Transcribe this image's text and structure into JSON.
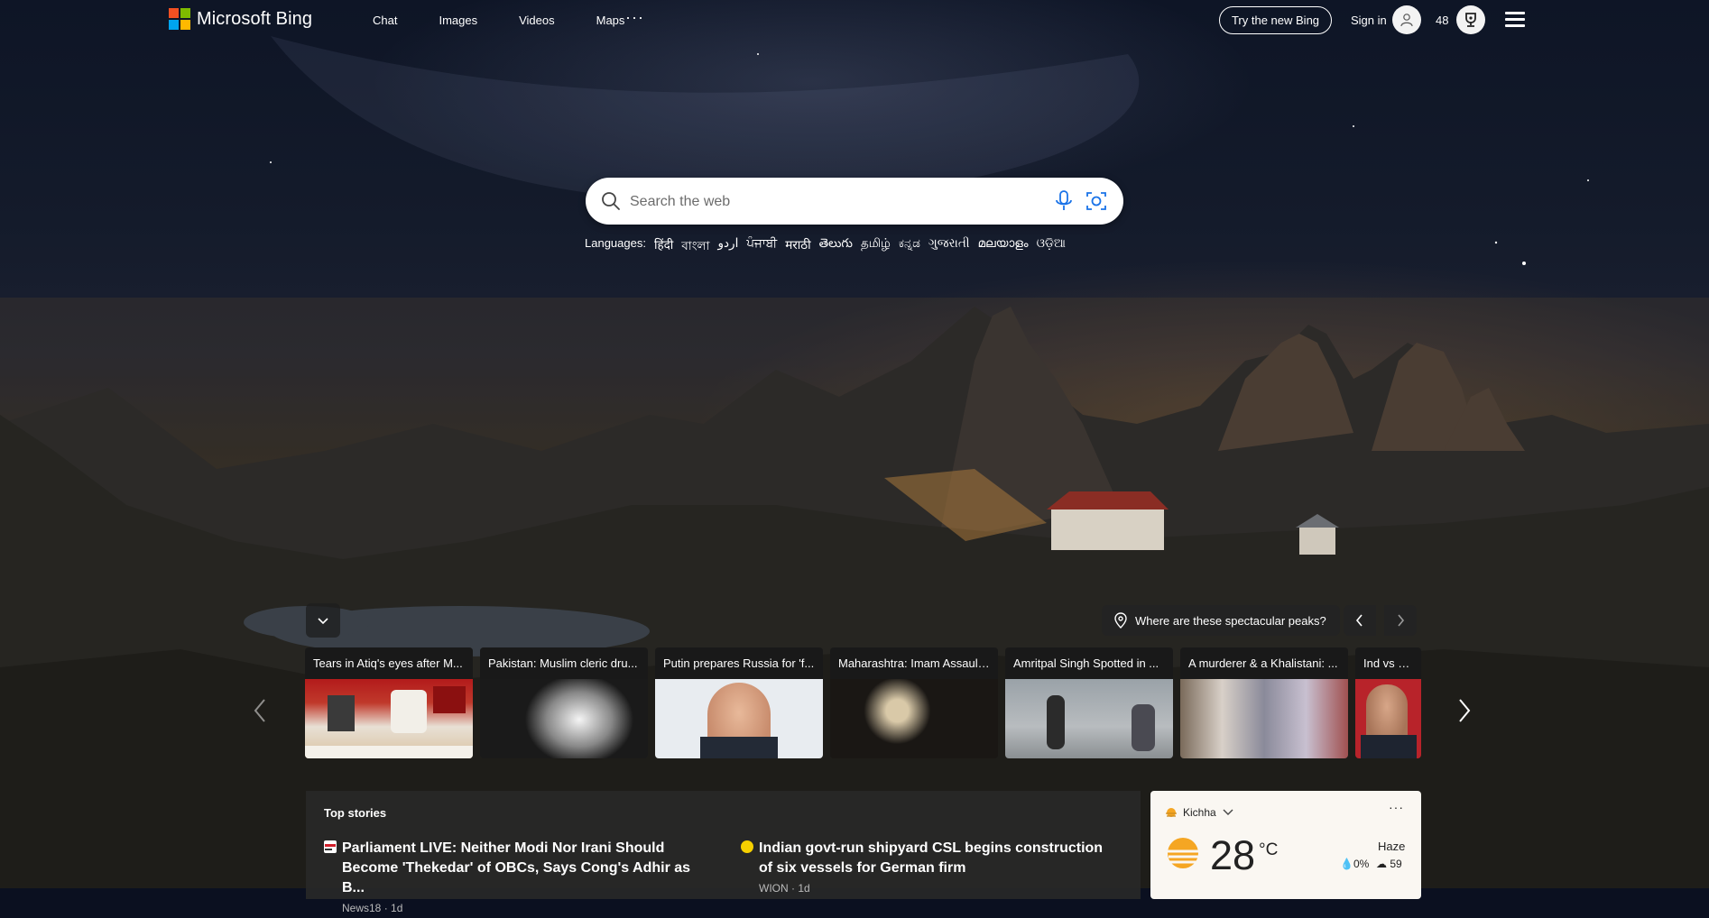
{
  "header": {
    "brand": "Microsoft Bing",
    "nav": [
      "Chat",
      "Images",
      "Videos",
      "Maps"
    ],
    "more": "···",
    "try_new_bing": "Try the new Bing",
    "sign_in": "Sign in",
    "reward_points": "48"
  },
  "search": {
    "placeholder": "Search the web",
    "languages_label": "Languages:",
    "languages": [
      "हिंदी",
      "বাংলা",
      "اردو",
      "ਪੰਜਾਬੀ",
      "मराठी",
      "తెలుగు",
      "தமிழ்",
      "ಕನ್ನಡ",
      "ગુજરાતી",
      "മലയാളം",
      "ଓଡ଼ିଆ"
    ]
  },
  "image_info": {
    "caption": "Where are these spectacular peaks?"
  },
  "carousel": {
    "cards": [
      {
        "title": "Tears in Atiq's eyes after M..."
      },
      {
        "title": "Pakistan: Muslim cleric dru..."
      },
      {
        "title": "Putin prepares Russia for 'f..."
      },
      {
        "title": "Maharashtra: Imam Assault..."
      },
      {
        "title": "Amritpal Singh Spotted in ..."
      },
      {
        "title": "A murderer & a Khalistani: ..."
      },
      {
        "title": "Ind vs Pak?"
      }
    ]
  },
  "top_stories": {
    "heading": "Top stories",
    "items": [
      {
        "title": "Parliament LIVE: Neither Modi Nor Irani Should Become 'Thekedar' of OBCs, Says Cong's Adhir as B...",
        "source": "News18 · 1d"
      },
      {
        "title": "Indian govt-run shipyard CSL begins construction of six vessels for German firm",
        "source": "WION · 1d"
      }
    ]
  },
  "weather": {
    "location": "Kichha",
    "menu": "···",
    "temperature": "28",
    "unit": "°C",
    "condition": "Haze",
    "precipitation": "0%",
    "aqi": "59"
  },
  "colors": {
    "ms_red": "#f25022",
    "ms_green": "#7fba00",
    "ms_blue": "#00a4ef",
    "ms_yellow": "#ffb900",
    "weather_sun": "#f5a623"
  }
}
